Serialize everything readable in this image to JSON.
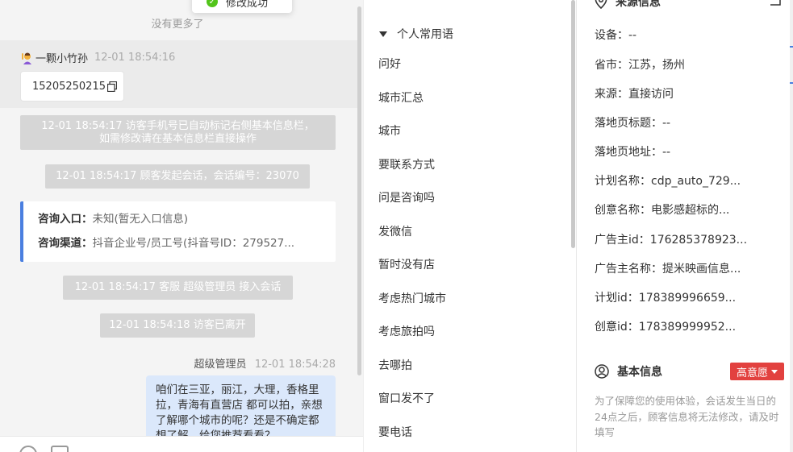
{
  "toast": {
    "text": "修改成功"
  },
  "chat": {
    "no_more": "没有更多了",
    "visitor": {
      "name": "一颗小竹孙",
      "time": "12-01 18:54:16",
      "phone": "15205250215"
    },
    "system_msgs": [
      "12-01 18:54:17 访客手机号已自动标记右侧基本信息栏，如需修改请在基本信息栏直接操作",
      "12-01 18:54:17 顾客发起会话，会话编号：23070",
      "12-01 18:54:17 客服 超级管理员 接入会话",
      "12-01 18:54:18 访客已离开"
    ],
    "consult": {
      "entry_key": "咨询入口：",
      "entry_val": "未知(暂无入口信息)",
      "channel_key": "咨询渠道：",
      "channel_val": "抖音企业号/员工号(抖音号ID：279527..."
    },
    "agent": {
      "name": "超级管理员",
      "time": "12-01 18:54:28",
      "text": "咱们在三亚，丽江，大理，香格里拉，青海有直营店 都可以拍，亲想了解哪个城市的呢？还是不确定都想了解，给您推荐看看？"
    },
    "toolbar": {
      "emoji_icon": "smile-icon",
      "image_icon": "image-icon"
    }
  },
  "phrases": {
    "group_title": "个人常用语",
    "items": [
      "问好",
      "城市汇总",
      "城市",
      "要联系方式",
      "问是咨询吗",
      "发微信",
      "暂时没有店",
      "考虑热门城市",
      "考虑旅拍吗",
      "去哪拍",
      "窗口发不了",
      "要电话"
    ]
  },
  "info": {
    "source_title": "来源信息",
    "rows": [
      {
        "key": "设备：",
        "val": "--"
      },
      {
        "key": "省市：",
        "val": "江苏，扬州"
      },
      {
        "key": "来源：",
        "val": "直接访问"
      },
      {
        "key": "落地页标题：",
        "val": "--"
      },
      {
        "key": "落地页地址：",
        "val": "--"
      },
      {
        "key": "计划名称：",
        "val": "cdp_auto_729..."
      },
      {
        "key": "创意名称：",
        "val": "电影感超标的..."
      },
      {
        "key": "广告主id：",
        "val": "176285378923..."
      },
      {
        "key": "广告主名称：",
        "val": "提米映画信息..."
      },
      {
        "key": "计划id：",
        "val": "178389996659..."
      },
      {
        "key": "创意id：",
        "val": "178389999952..."
      }
    ],
    "basic_title": "基本信息",
    "intent_tag": "高意愿",
    "notice": "为了保障您的使用体验，会话发生当日的24点之后，顾客信息将无法修改，请及时填写"
  },
  "colors": {
    "accent_blue": "#4a7fe0",
    "agent_bubble": "#dbe8fb",
    "intent_red": "#e2413f",
    "system_gray": "#d6d6d6",
    "success_green": "#52c41a"
  }
}
